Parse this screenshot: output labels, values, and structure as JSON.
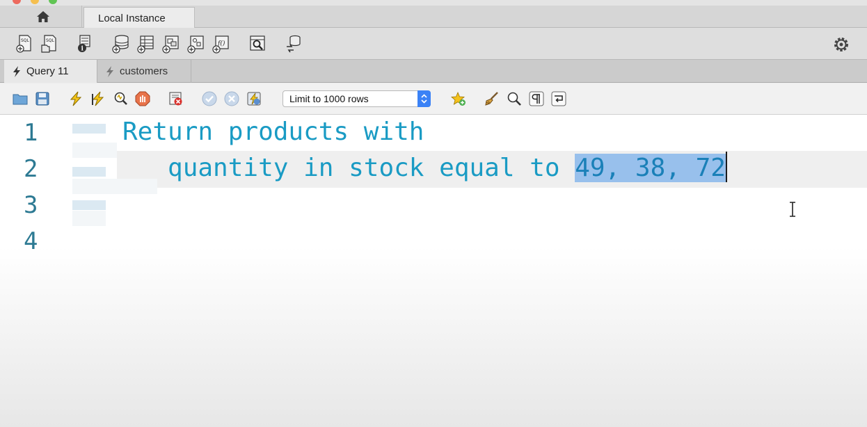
{
  "connection_tabs": {
    "home_icon": "home-icon",
    "instance_label": "Local Instance"
  },
  "main_toolbar": {
    "icons": [
      "new-sql-tab-icon",
      "open-sql-script-icon",
      "server-info-icon",
      "create-schema-icon",
      "create-table-icon",
      "create-view-icon",
      "create-procedure-icon",
      "create-function-icon",
      "search-table-data-icon",
      "reconnect-icon"
    ],
    "settings_icon": "gear-icon"
  },
  "query_tabs": [
    {
      "label": "Query 11",
      "icon": "lightning-icon",
      "active": true
    },
    {
      "label": "customers",
      "icon": "lightning-icon",
      "active": false
    }
  ],
  "editor_toolbar": {
    "icons": [
      "open-folder-icon",
      "save-icon",
      "execute-icon",
      "execute-current-icon",
      "explain-icon",
      "stop-icon",
      "toggle-error-icon",
      "commit-icon",
      "rollback-icon",
      "autocommit-icon",
      "favorite-snippet-icon",
      "beautify-icon",
      "find-icon",
      "invisible-chars-icon",
      "wrap-lines-icon"
    ],
    "limit_select": {
      "selected": "Limit to 1000 rows"
    }
  },
  "editor": {
    "line_numbers": [
      "1",
      "2",
      "3",
      "4"
    ],
    "line1_text": "Return products with",
    "line2_text_plain": "   quantity in stock equal to ",
    "line2_text_selected": "49, 38, 72",
    "accent_color": "#1a9bc4",
    "selection_color": "#98c0ec"
  }
}
